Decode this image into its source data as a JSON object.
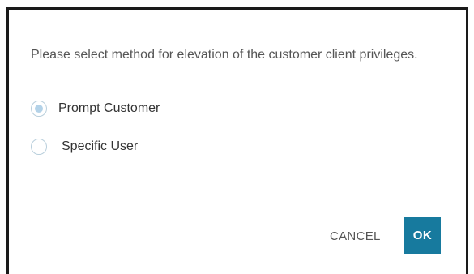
{
  "dialog": {
    "message": "Please select method for elevation of the customer client privileges.",
    "options": [
      {
        "label": "Prompt Customer",
        "selected": true
      },
      {
        "label": "Specific User",
        "selected": false
      }
    ],
    "cancel_label": "CANCEL",
    "ok_label": "OK"
  },
  "colors": {
    "ok_button_bg": "#177a9e",
    "radio_selected": "#b3d2e8",
    "radio_border": "#b9cfdc",
    "message_text": "#555555"
  }
}
